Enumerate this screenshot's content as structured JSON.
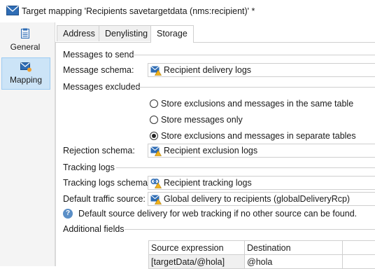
{
  "window": {
    "title": "Target mapping 'Recipients savetargetdata (nms:recipient)' *",
    "icon": "envelope-mapping-icon"
  },
  "sidebar": {
    "items": [
      {
        "label": "General",
        "icon": "document-icon",
        "active": false
      },
      {
        "label": "Mapping",
        "icon": "envelope-mapping-icon",
        "active": true
      }
    ]
  },
  "tabs": [
    {
      "label": "Address",
      "active": false
    },
    {
      "label": "Denylisting",
      "active": false
    },
    {
      "label": "Storage",
      "active": true
    }
  ],
  "storage": {
    "messages_to_send": {
      "section_label": "Messages to send",
      "schema_label": "Message schema:",
      "schema_value": "Recipient delivery logs"
    },
    "messages_excluded": {
      "section_label": "Messages excluded",
      "options": [
        {
          "label": "Store exclusions and messages in the same table",
          "selected": false
        },
        {
          "label": "Store messages only",
          "selected": false
        },
        {
          "label": "Store exclusions and messages in separate tables",
          "selected": true
        }
      ],
      "rejection_label": "Rejection schema:",
      "rejection_value": "Recipient exclusion logs"
    },
    "tracking_logs": {
      "section_label": "Tracking logs",
      "schema_label": "Tracking logs schema:",
      "schema_value": "Recipient tracking logs",
      "traffic_label": "Default traffic source:",
      "traffic_value": "Global delivery to recipients (globalDeliveryRcp)",
      "info_text": "Default source delivery for web tracking if no other source can be found."
    },
    "additional_fields": {
      "section_label": "Additional fields",
      "columns": [
        "Source expression",
        "Destination"
      ],
      "rows": [
        {
          "source": "[targetData/@hola]",
          "destination": "@hola"
        }
      ]
    }
  },
  "colors": {
    "sidebar_active_bg": "#cce4f7",
    "accent_blue": "#2b6cb0",
    "info_icon": "#5b8fc7"
  }
}
